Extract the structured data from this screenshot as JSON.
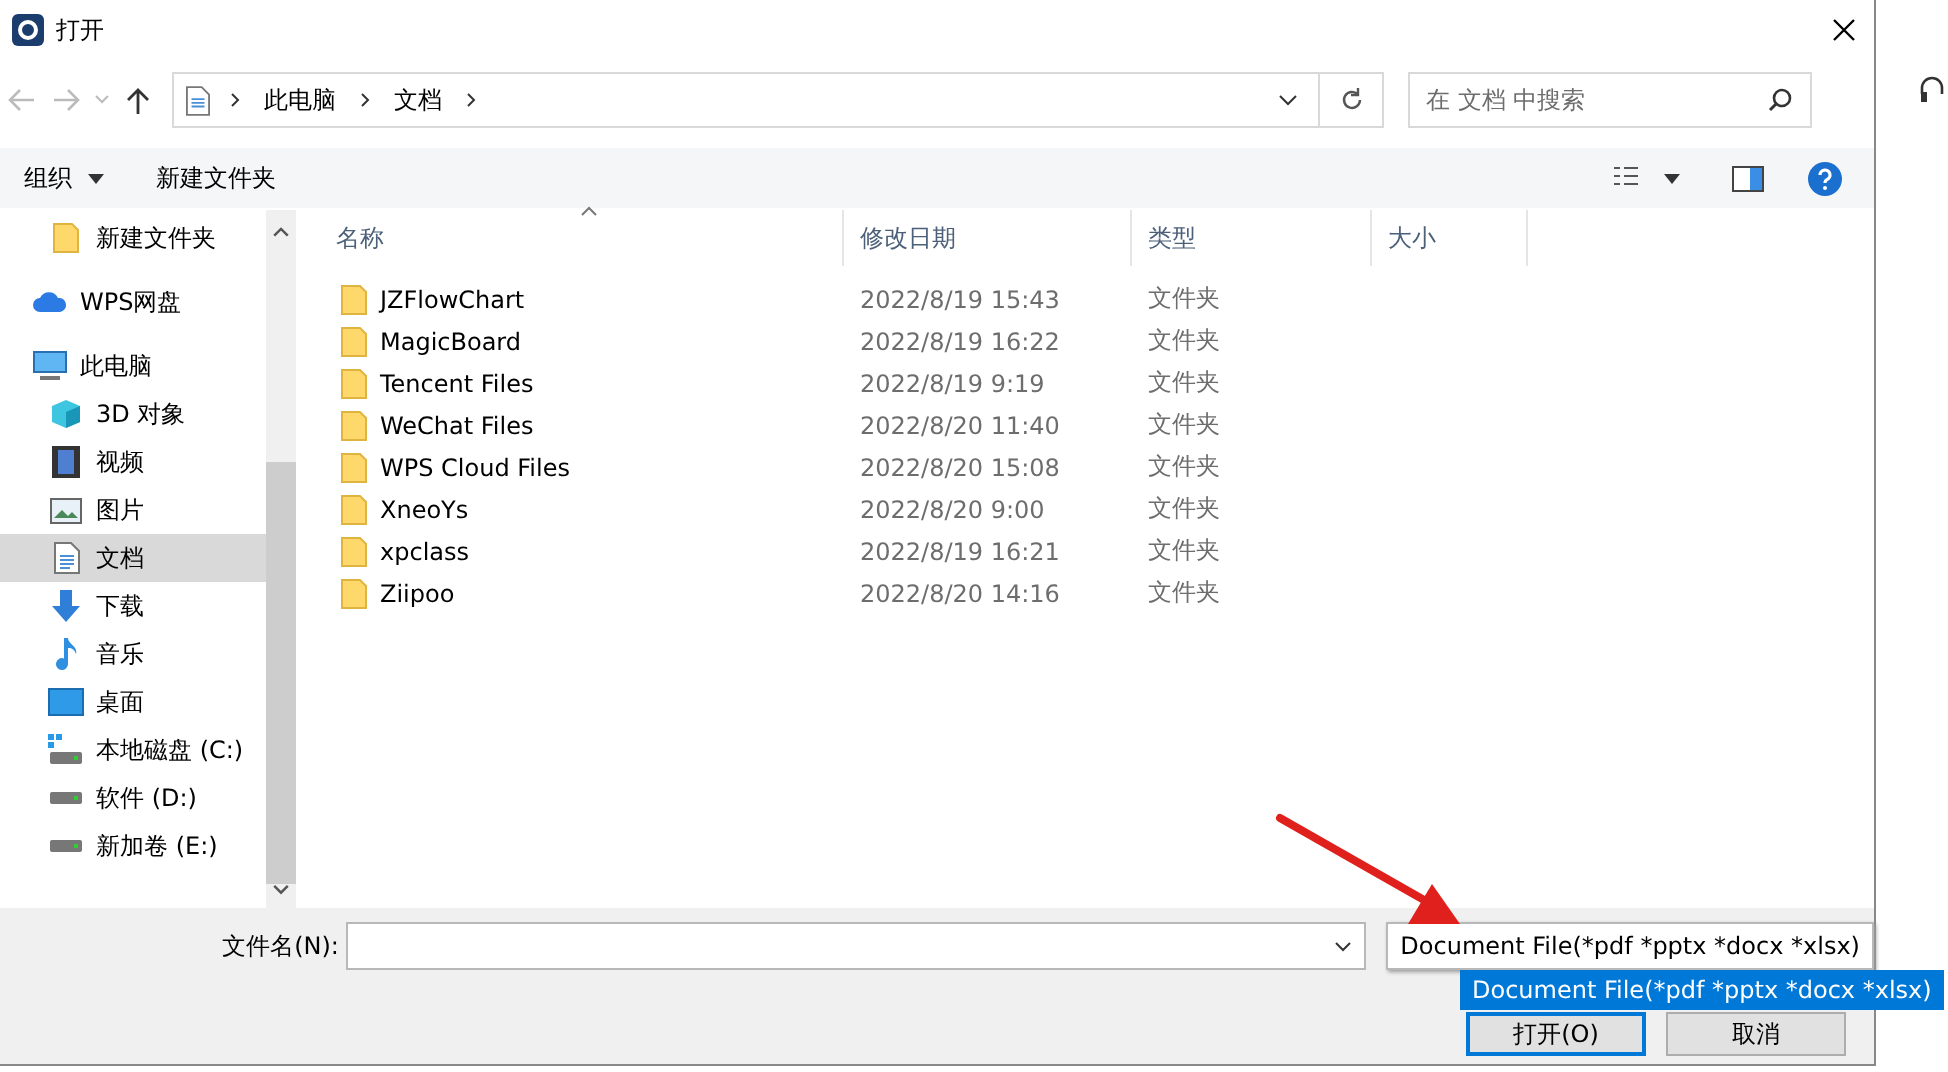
{
  "window": {
    "title": "打开"
  },
  "nav": {
    "breadcrumb": [
      "此电脑",
      "文档"
    ],
    "search": {
      "placeholder": "在 文档 中搜索"
    }
  },
  "toolbar": {
    "buttons": [
      "组织",
      "新建文件夹"
    ]
  },
  "sidebar": {
    "items": [
      {
        "label": "新建文件夹",
        "kind": "folder",
        "selected": false
      },
      {
        "label": "WPS网盘",
        "kind": "cloud",
        "selected": false
      },
      {
        "label": "此电脑",
        "kind": "pc",
        "selected": false,
        "children": [
          {
            "label": "3D 对象",
            "kind": "cube",
            "selected": false
          },
          {
            "label": "视频",
            "kind": "video",
            "selected": false
          },
          {
            "label": "图片",
            "kind": "pictures",
            "selected": false
          },
          {
            "label": "文档",
            "kind": "docs",
            "selected": true
          },
          {
            "label": "下载",
            "kind": "download",
            "selected": false
          },
          {
            "label": "音乐",
            "kind": "music",
            "selected": false
          },
          {
            "label": "桌面",
            "kind": "desktop",
            "selected": false
          },
          {
            "label": "本地磁盘 (C:)",
            "kind": "sysdrive",
            "selected": false
          },
          {
            "label": "软件 (D:)",
            "kind": "drive",
            "selected": false
          },
          {
            "label": "新加卷 (E:)",
            "kind": "drive",
            "selected": false
          }
        ]
      }
    ]
  },
  "table": {
    "columns": [
      "名称",
      "修改日期",
      "类型",
      "大小"
    ],
    "rows": [
      {
        "name": "JZFlowChart",
        "modified": "2022/8/19 15:43",
        "type": "文件夹"
      },
      {
        "name": "MagicBoard",
        "modified": "2022/8/19 16:22",
        "type": "文件夹"
      },
      {
        "name": "Tencent Files",
        "modified": "2022/8/19 9:19",
        "type": "文件夹"
      },
      {
        "name": "WeChat Files",
        "modified": "2022/8/20 11:40",
        "type": "文件夹"
      },
      {
        "name": "WPS Cloud Files",
        "modified": "2022/8/20 15:08",
        "type": "文件夹"
      },
      {
        "name": "XneoYs",
        "modified": "2022/8/20 9:00",
        "type": "文件夹"
      },
      {
        "name": "xpclass",
        "modified": "2022/8/19 16:21",
        "type": "文件夹"
      },
      {
        "name": "Ziipoo",
        "modified": "2022/8/20 14:16",
        "type": "文件夹"
      }
    ]
  },
  "bottom": {
    "filename_label": "文件名(N):",
    "file_type": "Document File(*pdf *pptx *docx *xlsx)",
    "file_type_options": [
      {
        "label": "Document File(*pdf *pptx *docx *xlsx)",
        "selected": true
      }
    ],
    "buttons": [
      "打开(O)",
      "取消"
    ]
  }
}
